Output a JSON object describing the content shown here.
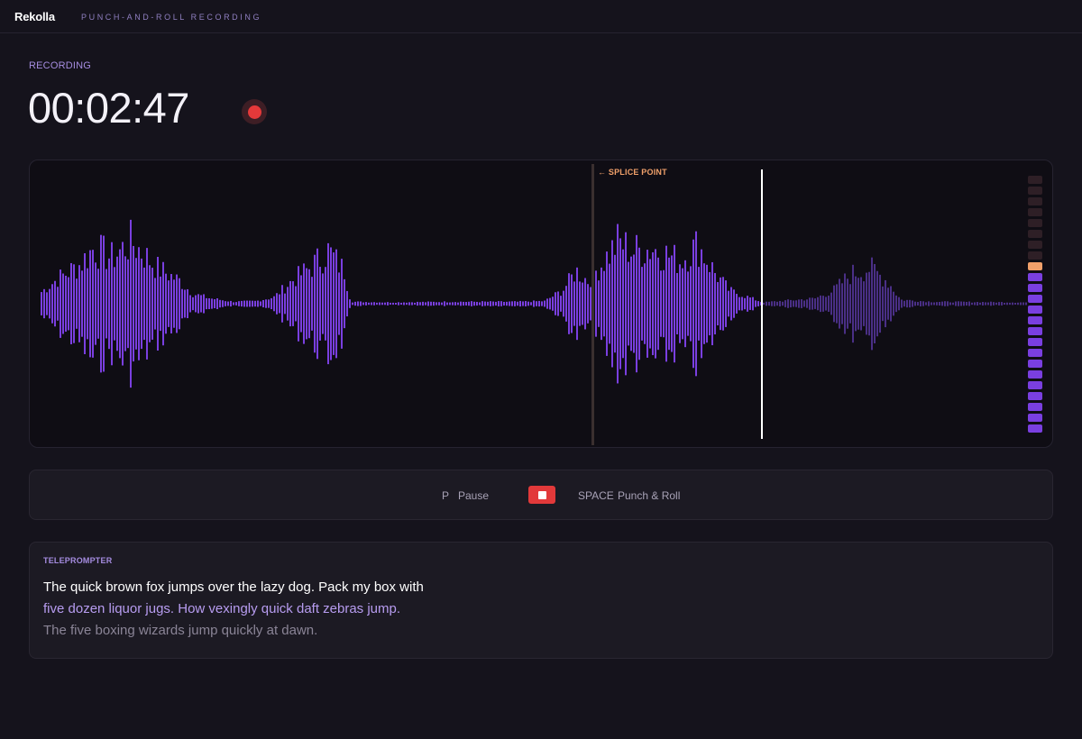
{
  "app": {
    "brand": "Rekolla",
    "subtitle": "PUNCH-AND-ROLL RECORDING"
  },
  "recording": {
    "label": "RECORDING",
    "timer": "00:02:47",
    "indicator_icon": "record-dot-icon"
  },
  "waveform": {
    "splice_label": "← SPLICE POINT",
    "colors": {
      "recorded": "#7a3fe0",
      "pending": "#4a2f86",
      "splice": "#3a2f2f",
      "playhead": "#ffffff"
    },
    "meter": {
      "segments": 24,
      "active_segments": 16,
      "peak_color": "#f0a06a",
      "active_color": "#7a3fe0",
      "inactive_color": "#2e1f26"
    }
  },
  "controls": {
    "pause_key": "P",
    "pause_label": "Pause",
    "stop_icon": "stop-icon",
    "punch_key": "SPACE",
    "punch_label": "Punch & Roll"
  },
  "teleprompter": {
    "label": "TELEPROMPTER",
    "lines": [
      "The quick brown fox jumps over the lazy dog. Pack my box with",
      "five dozen liquor jugs. How vexingly quick daft zebras jump.",
      "The five boxing wizards jump quickly at dawn."
    ]
  }
}
